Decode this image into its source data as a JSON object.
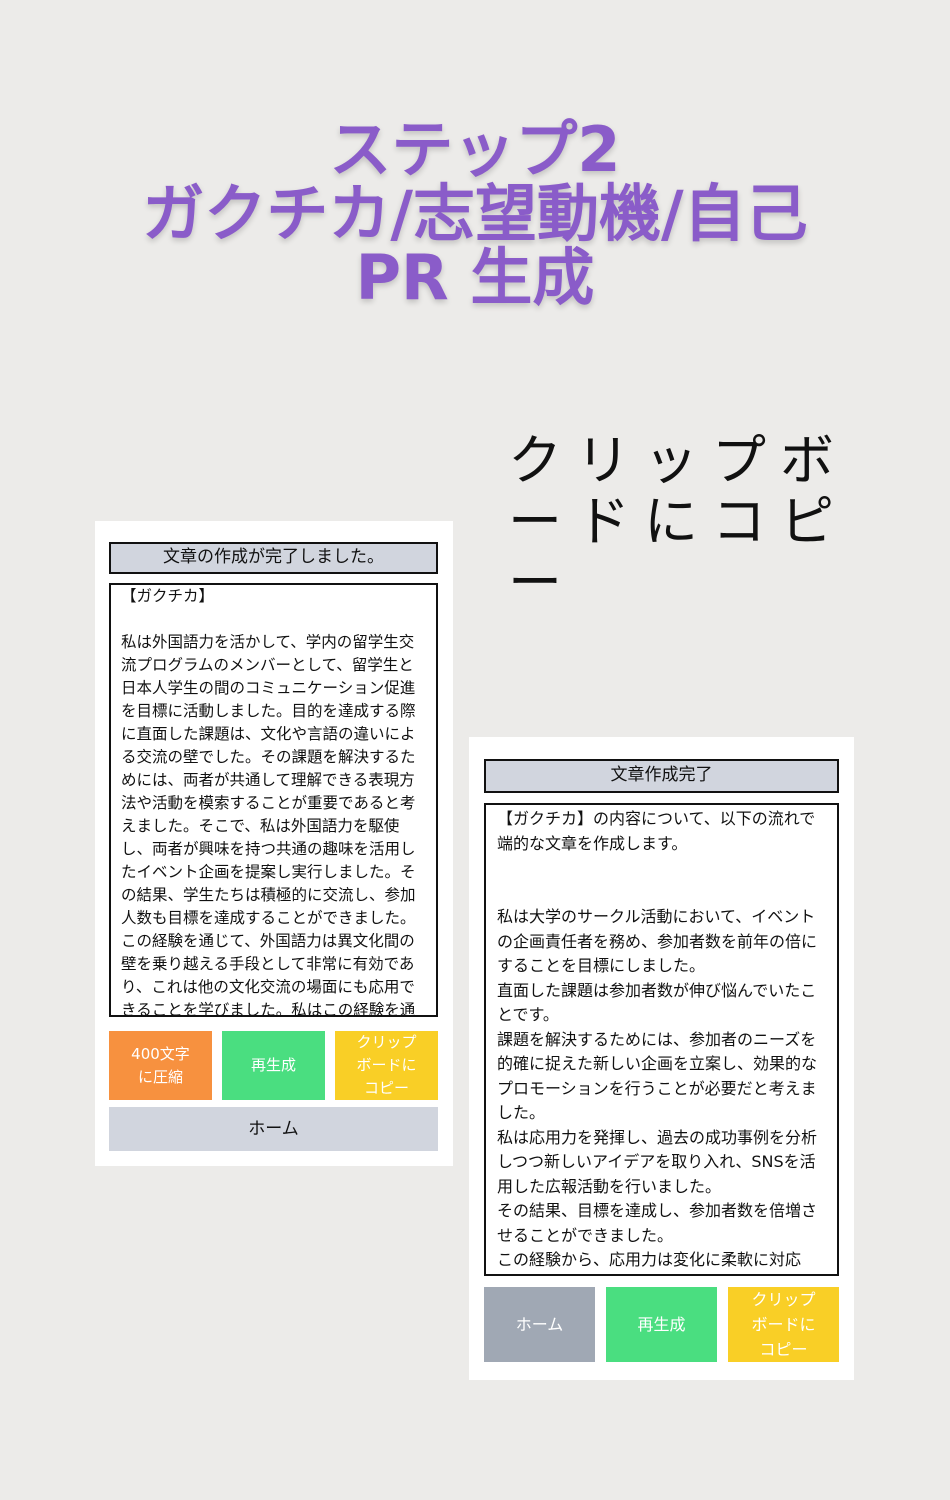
{
  "title": {
    "line1": "ステップ2",
    "line2": "ガクチカ/志望動機/自己",
    "line3": "PR 生成"
  },
  "caption": "クリップボードにコピー",
  "card1": {
    "header": "文章の作成が完了しました。",
    "body": "【ガクチカ】\n\n私は外国語力を活かして、学内の留学生交流プログラムのメンバーとして、留学生と日本人学生の間のコミュニケーション促進を目標に活動しました。目的を達成する際に直面した課題は、文化や言語の違いによる交流の壁でした。その課題を解決するためには、両者が共通して理解できる表現方法や活動を模索することが重要であると考えました。そこで、私は外国語力を駆使し、両者が興味を持つ共通の趣味を活用したイベント企画を提案し実行しました。その結果、学生たちは積極的に交流し、参加人数も目標を達成することができました。この経験を通じて、外国語力は異文化間の壁を乗り越える手段として非常に有効であり、これは他の文化交流の場面にも応用できることを学びました。私はこの経験を通",
    "buttons": {
      "compress": "400文字\nに圧縮",
      "regenerate": "再生成",
      "copy": "クリップ\nボードに\nコピー",
      "home": "ホーム"
    }
  },
  "card2": {
    "header": "文章作成完了",
    "body": "【ガクチカ】の内容について、以下の流れで端的な文章を作成します。\n\n\n私は大学のサークル活動において、イベントの企画責任者を務め、参加者数を前年の倍にすることを目標にしました。\n直面した課題は参加者数が伸び悩んでいたことです。\n課題を解決するためには、参加者のニーズを的確に捉えた新しい企画を立案し、効果的なプロモーションを行うことが必要だと考えました。\n私は応用力を発揮し、過去の成功事例を分析しつつ新しいアイデアを取り入れ、SNSを活用した広報活動を行いました。\nその結果、目標を達成し、参加者数を倍増させることができました。\nこの経験から、応用力は変化に柔軟に対応",
    "buttons": {
      "home": "ホーム",
      "regenerate": "再生成",
      "copy": "クリップ\nボードに\nコピー"
    }
  },
  "colors": {
    "title": "#8a5cc9",
    "orange": "#f7913f",
    "green": "#4ade80",
    "yellow": "#f9cf26",
    "gray": "#a0a8b4",
    "header_bg": "#d1d5de"
  }
}
